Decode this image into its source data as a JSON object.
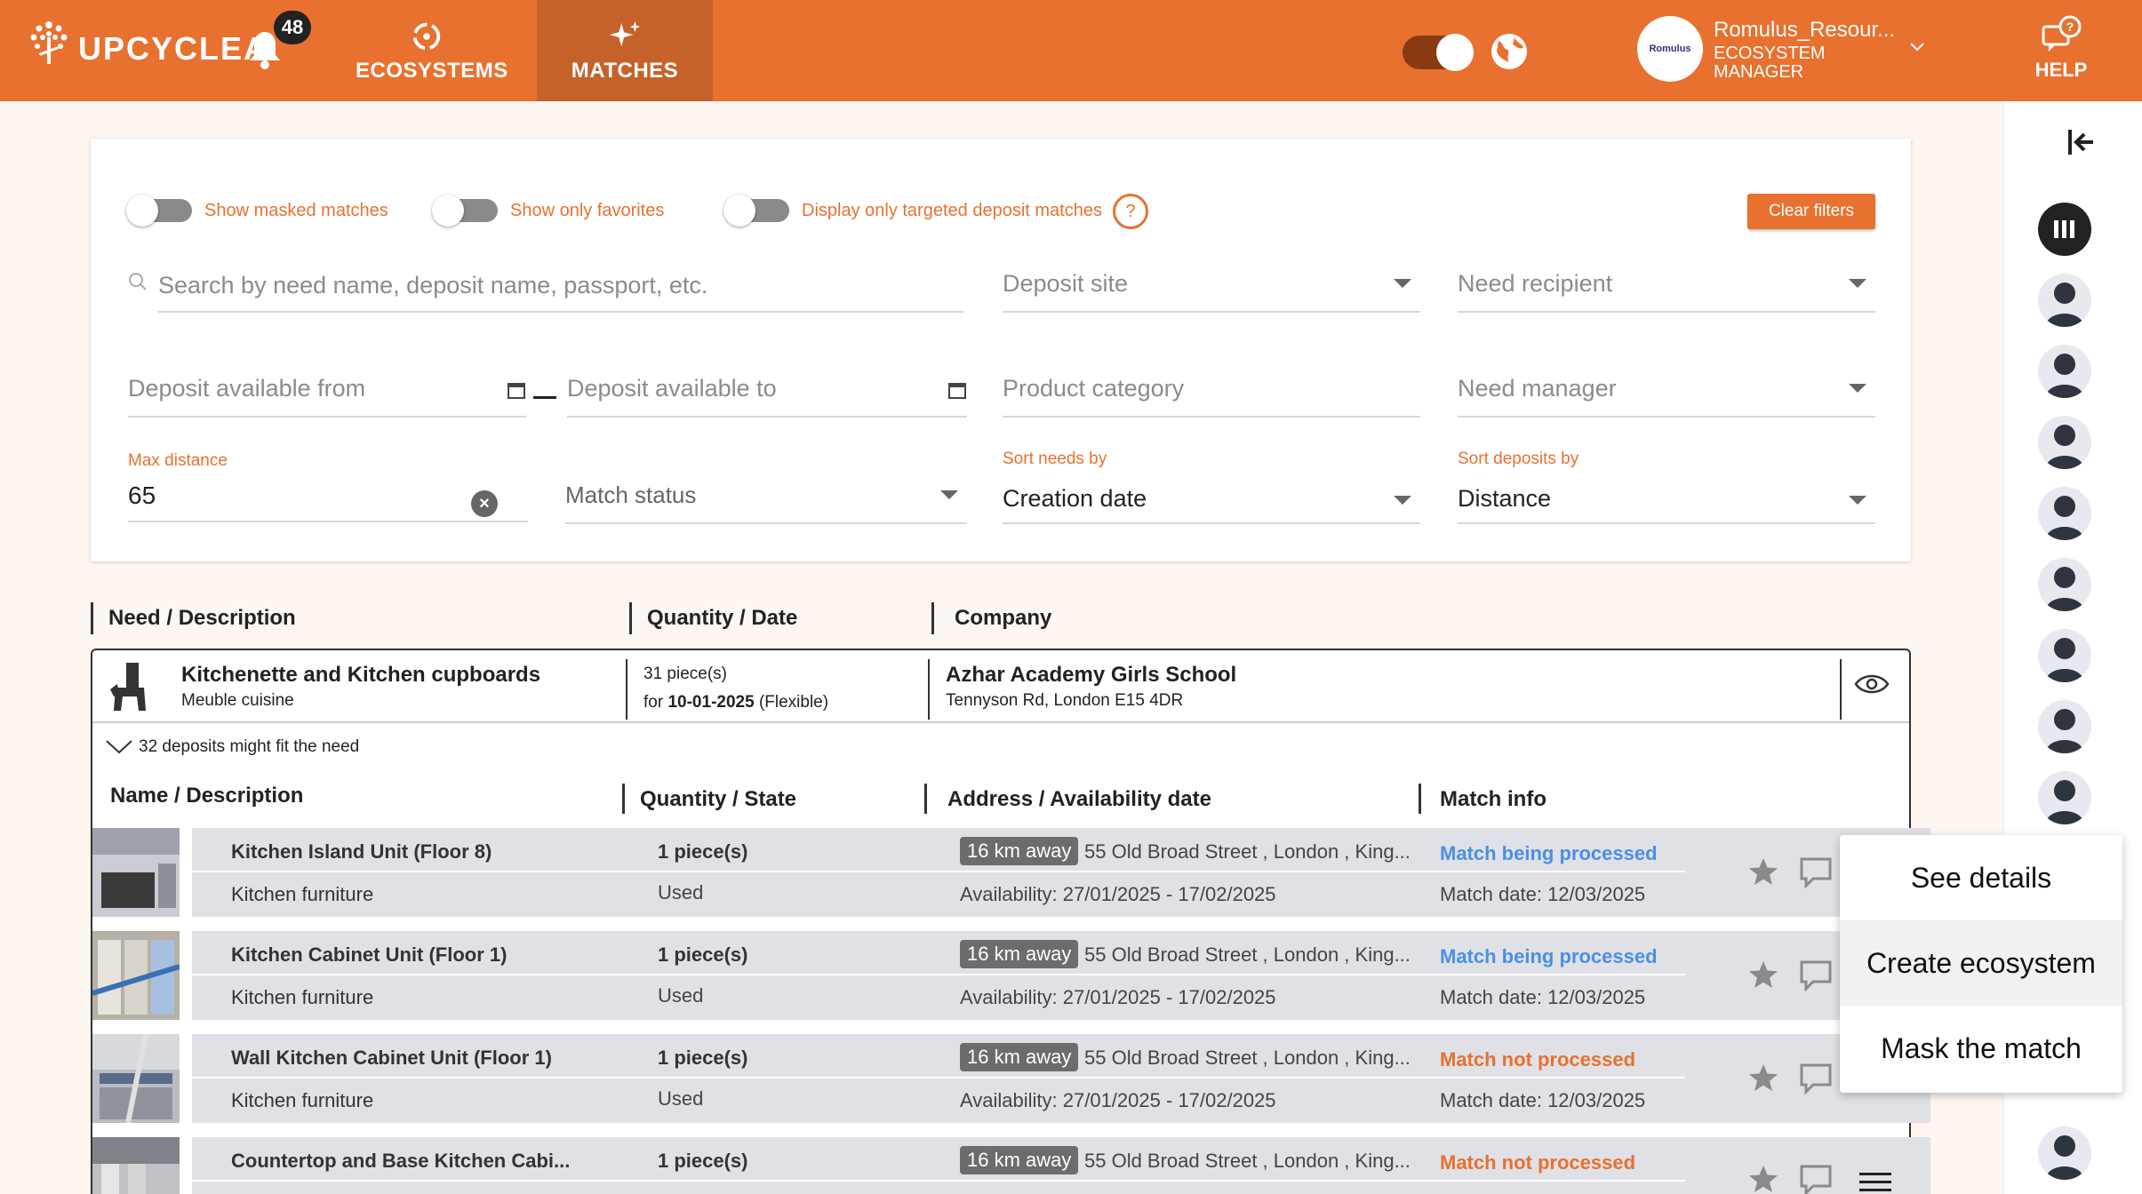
{
  "header": {
    "brand": "UPCYCLEA",
    "notifications_count": "48",
    "tabs": [
      {
        "label": "ECOSYSTEMS",
        "icon": "recycle-icon"
      },
      {
        "label": "MATCHES",
        "icon": "sparkles-icon"
      }
    ],
    "user": {
      "avatar_text": "Romulus",
      "name": "Romulus_Resour...",
      "role": "ECOSYSTEM MANAGER"
    },
    "help_label": "HELP"
  },
  "filters": {
    "toggles": {
      "masked": "Show masked matches",
      "favorites": "Show only favorites",
      "targeted": "Display only targeted deposit matches"
    },
    "help_symbol": "?",
    "clear_label": "Clear filters",
    "search_placeholder": "Search by need name, deposit name, passport, etc.",
    "deposit_site": "Deposit site",
    "need_recipient": "Need recipient",
    "available_from": "Deposit available from",
    "available_to": "Deposit available to",
    "product_category": "Product category",
    "need_manager": "Need manager",
    "max_distance_label": "Max distance",
    "max_distance_value": "65",
    "match_status": "Match status",
    "sort_needs_label": "Sort needs by",
    "sort_needs_value": "Creation date",
    "sort_deposits_label": "Sort deposits by",
    "sort_deposits_value": "Distance"
  },
  "table": {
    "headers": {
      "need": "Need / Description",
      "quantity": "Quantity / Date",
      "company": "Company"
    },
    "need": {
      "title": "Kitchenette and Kitchen cupboards",
      "subtitle": "Meuble cuisine",
      "qty": "31 piece(s)",
      "date_prefix": "for",
      "date": "10-01-2025",
      "date_suffix": "(Flexible)",
      "company": "Azhar Academy Girls School",
      "address": "Tennyson Rd, London E15 4DR"
    },
    "deposits_count": "32 deposits might fit the need",
    "deposit_headers": {
      "name": "Name / Description",
      "qty": "Quantity / State",
      "address": "Address / Availability date",
      "match": "Match info"
    },
    "deposits": [
      {
        "name": "Kitchen Island Unit (Floor 8)",
        "category": "Kitchen furniture",
        "qty": "1 piece(s)",
        "state": "Used",
        "distance": "16 km away",
        "address": "55 Old Broad Street , London , King...",
        "availability": "Availability: 27/01/2025 - 17/02/2025",
        "status": "Match being processed",
        "status_color": "#4a90e2",
        "match_date": "Match date: 12/03/2025"
      },
      {
        "name": "Kitchen Cabinet Unit (Floor 1)",
        "category": "Kitchen furniture",
        "qty": "1 piece(s)",
        "state": "Used",
        "distance": "16 km away",
        "address": "55 Old Broad Street , London , King...",
        "availability": "Availability: 27/01/2025 - 17/02/2025",
        "status": "Match being processed",
        "status_color": "#4a90e2",
        "match_date": "Match date: 12/03/2025"
      },
      {
        "name": "Wall Kitchen Cabinet Unit (Floor 1)",
        "category": "Kitchen furniture",
        "qty": "1 piece(s)",
        "state": "Used",
        "distance": "16 km away",
        "address": "55 Old Broad Street , London , King...",
        "availability": "Availability: 27/01/2025 - 17/02/2025",
        "status": "Match not processed",
        "status_color": "#e8712f",
        "match_date": "Match date: 12/03/2025"
      },
      {
        "name": "Countertop and Base Kitchen Cabi...",
        "category": "",
        "qty": "1 piece(s)",
        "state": "",
        "distance": "16 km away",
        "address": "55 Old Broad Street , London , King...",
        "availability": "",
        "status": "Match not processed",
        "status_color": "#e8712f",
        "match_date": ""
      }
    ]
  },
  "popup_menu": {
    "see_details": "See details",
    "create_ecosystem": "Create ecosystem",
    "mask_match": "Mask the match"
  },
  "colors": {
    "brand_orange": "#e8712f",
    "active_tab": "#c4622a",
    "processing_blue": "#4a90e2"
  }
}
